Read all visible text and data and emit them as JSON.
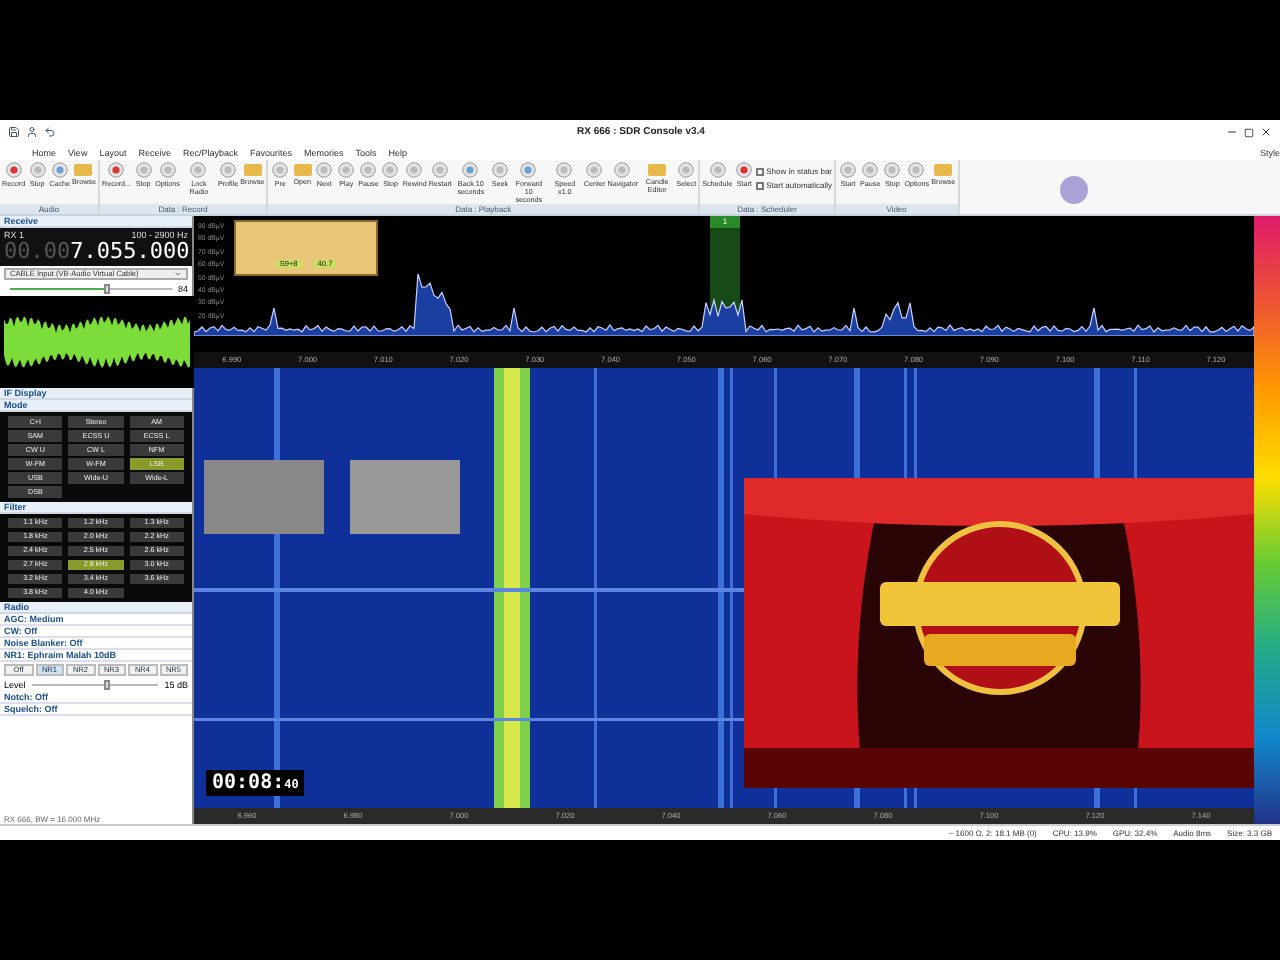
{
  "window": {
    "title": "RX 666 : SDR Console v3.4",
    "style_label": "Style"
  },
  "menu": [
    "Home",
    "View",
    "Layout",
    "Receive",
    "Rec/Playback",
    "Favourites",
    "Memories",
    "Tools",
    "Help"
  ],
  "ribbon": [
    {
      "label": "Audio",
      "buttons": [
        {
          "label": "Record",
          "kind": "record"
        },
        {
          "label": "Stop",
          "kind": "plain"
        },
        {
          "label": "Cache",
          "kind": "clock"
        },
        {
          "label": "Browse",
          "kind": "folder"
        }
      ]
    },
    {
      "label": "Data : Record",
      "buttons": [
        {
          "label": "Record...",
          "kind": "record"
        },
        {
          "label": "Stop",
          "kind": "plain"
        },
        {
          "label": "Options",
          "kind": "plain"
        },
        {
          "label": "Lock Radio",
          "kind": "plain"
        },
        {
          "label": "Profile",
          "kind": "plain"
        },
        {
          "label": "Browse",
          "kind": "folder"
        }
      ]
    },
    {
      "label": "Data : Playback",
      "buttons": [
        {
          "label": "Pre",
          "kind": "plain"
        },
        {
          "label": "Open",
          "kind": "folder"
        },
        {
          "label": "Next",
          "kind": "plain"
        },
        {
          "label": "Play",
          "kind": "plain"
        },
        {
          "label": "Pause",
          "kind": "plain"
        },
        {
          "label": "Stop",
          "kind": "plain"
        },
        {
          "label": "Rewind",
          "kind": "plain"
        },
        {
          "label": "Restart",
          "kind": "plain"
        },
        {
          "label": "Back 10 seconds",
          "kind": "clock"
        },
        {
          "label": "Seek",
          "kind": "plain"
        },
        {
          "label": "Forward 10 seconds",
          "kind": "clock"
        },
        {
          "label": "Speed x1.0",
          "kind": "plain"
        },
        {
          "label": "Center",
          "kind": "plain"
        },
        {
          "label": "Navigator",
          "kind": "plain"
        },
        {
          "label": "Candle Editor",
          "kind": "folder"
        },
        {
          "label": "Select",
          "kind": "plain"
        }
      ]
    },
    {
      "label": "Data : Scheduler",
      "buttons": [
        {
          "label": "Schedule",
          "kind": "plain"
        },
        {
          "label": "Start",
          "kind": "record"
        }
      ],
      "checks": [
        {
          "label": "Show in status bar",
          "checked": false
        },
        {
          "label": "Start automatically",
          "checked": false
        }
      ]
    },
    {
      "label": "Video",
      "buttons": [
        {
          "label": "Start",
          "kind": "plain"
        },
        {
          "label": "Pause",
          "kind": "plain"
        },
        {
          "label": "Stop",
          "kind": "plain"
        },
        {
          "label": "Options",
          "kind": "plain"
        },
        {
          "label": "Browse",
          "kind": "folder"
        }
      ]
    }
  ],
  "panel": {
    "title": "Receive",
    "rx": "RX 1",
    "bandwidth": "100 - 2900 Hz",
    "frequency_dim": "00.00",
    "frequency": "7.055.000",
    "audio_output": "CABLE Input (VB-Audio Virtual Cable)",
    "volume": {
      "level": 0.6,
      "reading": "84"
    },
    "if_display": "IF Display",
    "mode_title": "Mode",
    "modes": [
      {
        "label": "C+I",
        "selected": false
      },
      {
        "label": "Stereo",
        "selected": false
      },
      {
        "label": "AM",
        "selected": false
      },
      {
        "label": "SAM",
        "selected": false
      },
      {
        "label": "ECSS U",
        "selected": false
      },
      {
        "label": "ECSS L",
        "selected": false
      },
      {
        "label": "CW U",
        "selected": false
      },
      {
        "label": "CW L",
        "selected": false
      },
      {
        "label": "NFM",
        "selected": false
      },
      {
        "label": "W-FM",
        "selected": false
      },
      {
        "label": "W-FM",
        "selected": false
      },
      {
        "label": "LSB",
        "selected": true
      },
      {
        "label": "USB",
        "selected": false
      },
      {
        "label": "Wide-U",
        "selected": false
      },
      {
        "label": "Wide-L",
        "selected": false
      },
      {
        "label": "DSB",
        "selected": false
      }
    ],
    "filter_title": "Filter",
    "filters": [
      {
        "label": "1.1 kHz",
        "selected": false
      },
      {
        "label": "1.2 kHz",
        "selected": false
      },
      {
        "label": "1.3 kHz",
        "selected": false
      },
      {
        "label": "1.8 kHz",
        "selected": false
      },
      {
        "label": "2.0 kHz",
        "selected": false
      },
      {
        "label": "2.2 kHz",
        "selected": false
      },
      {
        "label": "2.4 kHz",
        "selected": false
      },
      {
        "label": "2.5 kHz",
        "selected": false
      },
      {
        "label": "2.6 kHz",
        "selected": false
      },
      {
        "label": "2.7 kHz",
        "selected": false
      },
      {
        "label": "2.8 kHz",
        "selected": true
      },
      {
        "label": "3.0 kHz",
        "selected": false
      },
      {
        "label": "3.2 kHz",
        "selected": false
      },
      {
        "label": "3.4 kHz",
        "selected": false
      },
      {
        "label": "3.6 kHz",
        "selected": false
      },
      {
        "label": "3.8 kHz",
        "selected": false
      },
      {
        "label": "4.0 kHz",
        "selected": false
      }
    ],
    "radio_title": "Radio",
    "radio_rows": [
      "AGC: Medium",
      "CW: Off",
      "Noise Blanker: Off",
      "NR1: Ephraim Malah 10dB"
    ],
    "nr": [
      {
        "label": "Off",
        "selected": false
      },
      {
        "label": "NR1",
        "selected": true
      },
      {
        "label": "NR2",
        "selected": false
      },
      {
        "label": "NR3",
        "selected": false
      },
      {
        "label": "NR4",
        "selected": false
      },
      {
        "label": "NR5",
        "selected": false
      }
    ],
    "nr_level": {
      "label": "Level",
      "level": 0.6,
      "reading": "15 dB"
    },
    "bottom_rows": [
      "Notch: Off",
      "Squelch: Off"
    ],
    "status": "RX 666, BW = 16.000 MHz"
  },
  "spectrum": {
    "db_labels": [
      "90 dBµV",
      "80 dBµV",
      "70 dBµV",
      "60 dBµV",
      "50 dBµV",
      "40 dBµV",
      "30 dBµV",
      "20 dBµV"
    ],
    "meter": {
      "s_reading": "S9+8",
      "db_reading": "40.7"
    },
    "marker": "1",
    "scale": [
      "6.990",
      "7.000",
      "7.010",
      "7.020",
      "7.030",
      "7.040",
      "7.050",
      "7.060",
      "7.070",
      "7.080",
      "7.090",
      "7.100",
      "7.110",
      "7.120"
    ]
  },
  "overlay": {
    "timer_main": "00:08:",
    "timer_small": "40"
  },
  "bottom_scale": [
    "6.960",
    "6.980",
    "7.000",
    "7.020",
    "7.040",
    "7.060",
    "7.080",
    "7.100",
    "7.120",
    "7.140"
  ],
  "status_bar": [
    "~ 1600 Ω, 2: 18.1 MB (0)",
    "CPU: 13.9%",
    "GPU: 32.4%",
    "Audio 8ms",
    "Size: 3.3 GB"
  ]
}
